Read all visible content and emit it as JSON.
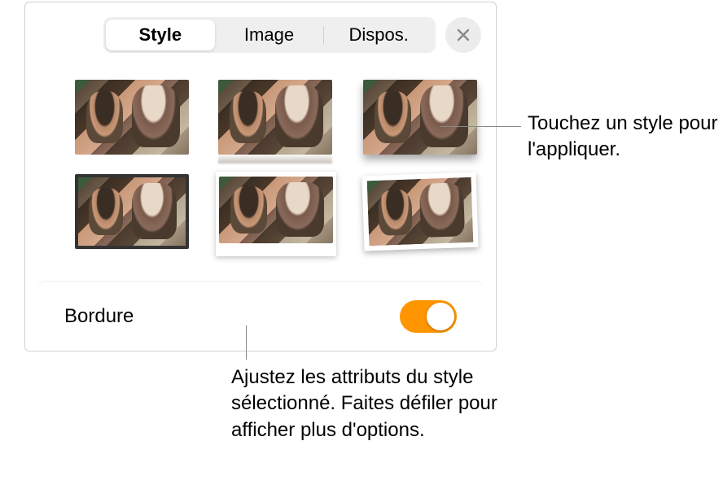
{
  "tabs": {
    "style": "Style",
    "image": "Image",
    "dispos": "Dispos."
  },
  "active_tab": "style",
  "border": {
    "label": "Bordure",
    "enabled": true
  },
  "toggle_color": "#ff9500",
  "style_presets": [
    {
      "id": "plain",
      "selected": false
    },
    {
      "id": "reflection",
      "selected": false
    },
    {
      "id": "shadow",
      "selected": false
    },
    {
      "id": "frame",
      "selected": false
    },
    {
      "id": "polaroid",
      "selected": false
    },
    {
      "id": "tilted",
      "selected": false
    }
  ],
  "callouts": {
    "apply_style": "Touchez un style pour l'appliquer.",
    "adjust_attributes": "Ajustez les attributs du style sélectionné. Faites défiler pour afficher plus d'options."
  }
}
